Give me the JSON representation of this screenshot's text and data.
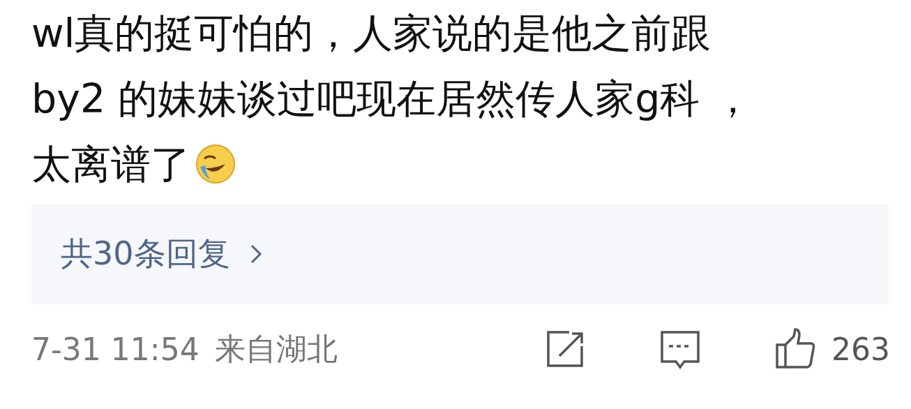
{
  "comment": {
    "lines": [
      "wl真的挺可怕的，人家说的是他之前跟",
      "by2 的妹妹谈过吧现在居然传人家g科 ，",
      "太离谱了"
    ]
  },
  "replies": {
    "label": "共30条回复"
  },
  "footer": {
    "time": "7-31 11:54",
    "location": "来自湖北",
    "likes": "263"
  }
}
